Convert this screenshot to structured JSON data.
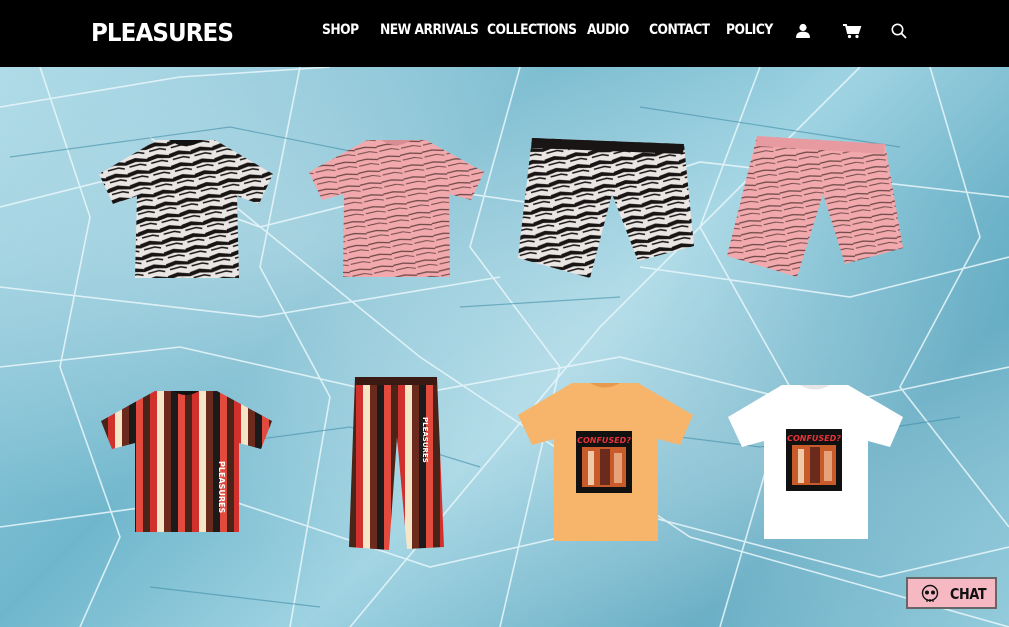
{
  "header": {
    "logo": "PLEASURES",
    "nav": [
      {
        "label": "SHOP"
      },
      {
        "label": "NEW ARRIVALS"
      },
      {
        "label": "COLLECTIONS"
      },
      {
        "label": "AUDIO"
      },
      {
        "label": "CONTACT"
      },
      {
        "label": "POLICY"
      }
    ],
    "icons": [
      "account-icon",
      "cart-icon",
      "search-icon"
    ]
  },
  "products": [
    {
      "name": "black zebra tee",
      "color": "#1a1515"
    },
    {
      "name": "pink zebra tee",
      "color": "#f2a9ad"
    },
    {
      "name": "black zebra shorts",
      "color": "#1a1515"
    },
    {
      "name": "pink zebra shorts",
      "color": "#f2a9ad"
    },
    {
      "name": "striped tee",
      "print": "PLEASURES"
    },
    {
      "name": "striped pants",
      "print": "PLEASURES"
    },
    {
      "name": "orange confused tee",
      "print": "CONFUSED?",
      "color": "#f6b56a"
    },
    {
      "name": "white confused tee",
      "print": "CONFUSED?",
      "color": "#ffffff"
    }
  ],
  "chat": {
    "label": "CHAT",
    "color": "#f6b9c4"
  }
}
